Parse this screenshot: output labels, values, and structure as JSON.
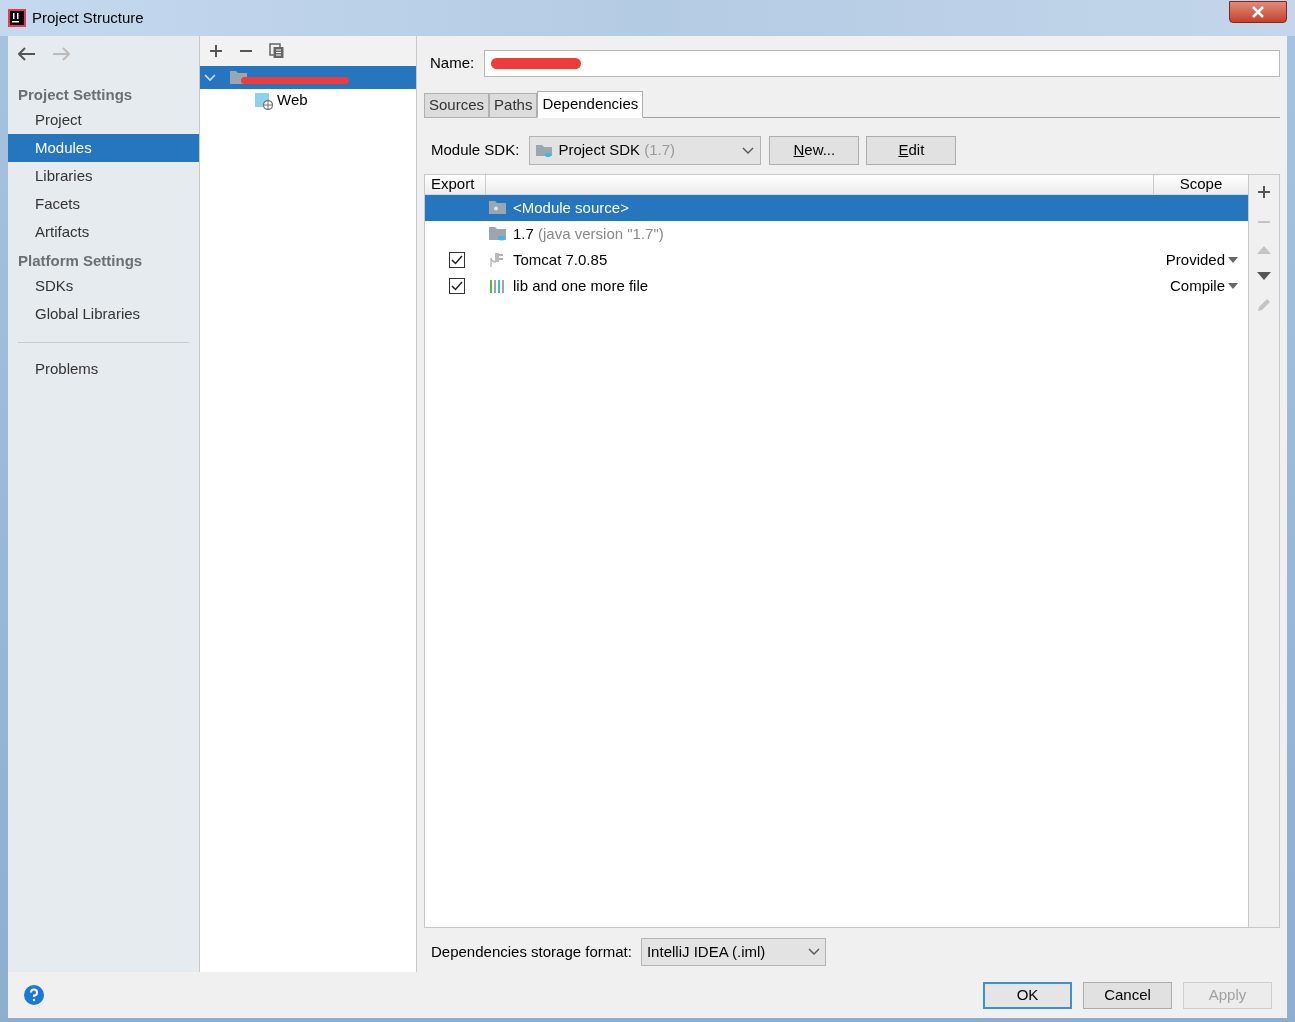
{
  "window": {
    "title": "Project Structure"
  },
  "nav": {
    "back_enabled": true,
    "forward_enabled": false
  },
  "sidebar": {
    "sections": [
      {
        "heading": "Project Settings",
        "items": [
          {
            "label": "Project",
            "selected": false
          },
          {
            "label": "Modules",
            "selected": true
          },
          {
            "label": "Libraries",
            "selected": false
          },
          {
            "label": "Facets",
            "selected": false
          },
          {
            "label": "Artifacts",
            "selected": false
          }
        ]
      },
      {
        "heading": "Platform Settings",
        "items": [
          {
            "label": "SDKs",
            "selected": false
          },
          {
            "label": "Global Libraries",
            "selected": false
          }
        ]
      }
    ],
    "footer_items": [
      {
        "label": "Problems",
        "selected": false
      }
    ]
  },
  "module_tree": {
    "items": [
      {
        "kind": "module",
        "redacted": true,
        "selected": true,
        "expanded": true,
        "children": [
          {
            "kind": "web",
            "label": "Web",
            "selected": false
          }
        ]
      }
    ]
  },
  "name_field": {
    "label": "Name:",
    "redacted": true
  },
  "tabs": [
    {
      "label": "Sources",
      "selected": false
    },
    {
      "label": "Paths",
      "selected": false
    },
    {
      "label": "Dependencies",
      "selected": true
    }
  ],
  "module_sdk": {
    "label": "Module SDK:",
    "value": "Project SDK",
    "detail": "(1.7)",
    "buttons": [
      {
        "label": "New...",
        "underline_first": true
      },
      {
        "label": "Edit",
        "underline_first": true
      }
    ]
  },
  "dependencies": {
    "columns": [
      "Export",
      "Scope"
    ],
    "rows": [
      {
        "kind": "module",
        "name": "<Module source>",
        "selected": true
      },
      {
        "kind": "sdk",
        "name": "1.7",
        "detail": "(java version \"1.7\")",
        "selected": false
      },
      {
        "kind": "server",
        "name": "Tomcat 7.0.85",
        "export_checked": true,
        "scope": "Provided",
        "selected": false
      },
      {
        "kind": "library",
        "name": "lib and one more file",
        "export_checked": true,
        "scope": "Compile",
        "selected": false
      }
    ],
    "tools": [
      {
        "kind": "add",
        "disabled": false
      },
      {
        "kind": "remove",
        "disabled": true
      },
      {
        "kind": "up",
        "disabled": true
      },
      {
        "kind": "down",
        "disabled": false
      },
      {
        "kind": "edit",
        "disabled": true
      }
    ]
  },
  "storage_format": {
    "label": "Dependencies storage format:",
    "value": "IntelliJ IDEA (.iml)"
  },
  "buttons": [
    {
      "label": "OK",
      "default": true,
      "disabled": false
    },
    {
      "label": "Cancel",
      "default": false,
      "disabled": false
    },
    {
      "label": "Apply",
      "default": false,
      "disabled": true
    }
  ]
}
